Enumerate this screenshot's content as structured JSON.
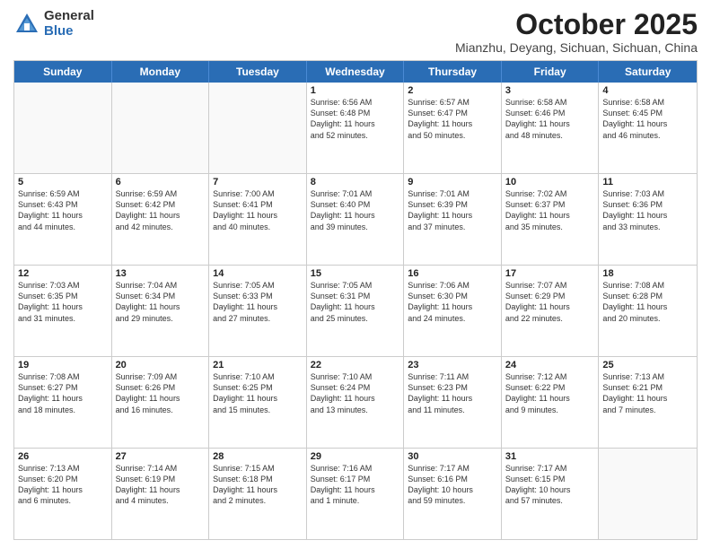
{
  "logo": {
    "general": "General",
    "blue": "Blue"
  },
  "title": {
    "month": "October 2025",
    "location": "Mianzhu, Deyang, Sichuan, Sichuan, China"
  },
  "header_days": [
    "Sunday",
    "Monday",
    "Tuesday",
    "Wednesday",
    "Thursday",
    "Friday",
    "Saturday"
  ],
  "weeks": [
    [
      {
        "day": "",
        "info": ""
      },
      {
        "day": "",
        "info": ""
      },
      {
        "day": "",
        "info": ""
      },
      {
        "day": "1",
        "info": "Sunrise: 6:56 AM\nSunset: 6:48 PM\nDaylight: 11 hours\nand 52 minutes."
      },
      {
        "day": "2",
        "info": "Sunrise: 6:57 AM\nSunset: 6:47 PM\nDaylight: 11 hours\nand 50 minutes."
      },
      {
        "day": "3",
        "info": "Sunrise: 6:58 AM\nSunset: 6:46 PM\nDaylight: 11 hours\nand 48 minutes."
      },
      {
        "day": "4",
        "info": "Sunrise: 6:58 AM\nSunset: 6:45 PM\nDaylight: 11 hours\nand 46 minutes."
      }
    ],
    [
      {
        "day": "5",
        "info": "Sunrise: 6:59 AM\nSunset: 6:43 PM\nDaylight: 11 hours\nand 44 minutes."
      },
      {
        "day": "6",
        "info": "Sunrise: 6:59 AM\nSunset: 6:42 PM\nDaylight: 11 hours\nand 42 minutes."
      },
      {
        "day": "7",
        "info": "Sunrise: 7:00 AM\nSunset: 6:41 PM\nDaylight: 11 hours\nand 40 minutes."
      },
      {
        "day": "8",
        "info": "Sunrise: 7:01 AM\nSunset: 6:40 PM\nDaylight: 11 hours\nand 39 minutes."
      },
      {
        "day": "9",
        "info": "Sunrise: 7:01 AM\nSunset: 6:39 PM\nDaylight: 11 hours\nand 37 minutes."
      },
      {
        "day": "10",
        "info": "Sunrise: 7:02 AM\nSunset: 6:37 PM\nDaylight: 11 hours\nand 35 minutes."
      },
      {
        "day": "11",
        "info": "Sunrise: 7:03 AM\nSunset: 6:36 PM\nDaylight: 11 hours\nand 33 minutes."
      }
    ],
    [
      {
        "day": "12",
        "info": "Sunrise: 7:03 AM\nSunset: 6:35 PM\nDaylight: 11 hours\nand 31 minutes."
      },
      {
        "day": "13",
        "info": "Sunrise: 7:04 AM\nSunset: 6:34 PM\nDaylight: 11 hours\nand 29 minutes."
      },
      {
        "day": "14",
        "info": "Sunrise: 7:05 AM\nSunset: 6:33 PM\nDaylight: 11 hours\nand 27 minutes."
      },
      {
        "day": "15",
        "info": "Sunrise: 7:05 AM\nSunset: 6:31 PM\nDaylight: 11 hours\nand 25 minutes."
      },
      {
        "day": "16",
        "info": "Sunrise: 7:06 AM\nSunset: 6:30 PM\nDaylight: 11 hours\nand 24 minutes."
      },
      {
        "day": "17",
        "info": "Sunrise: 7:07 AM\nSunset: 6:29 PM\nDaylight: 11 hours\nand 22 minutes."
      },
      {
        "day": "18",
        "info": "Sunrise: 7:08 AM\nSunset: 6:28 PM\nDaylight: 11 hours\nand 20 minutes."
      }
    ],
    [
      {
        "day": "19",
        "info": "Sunrise: 7:08 AM\nSunset: 6:27 PM\nDaylight: 11 hours\nand 18 minutes."
      },
      {
        "day": "20",
        "info": "Sunrise: 7:09 AM\nSunset: 6:26 PM\nDaylight: 11 hours\nand 16 minutes."
      },
      {
        "day": "21",
        "info": "Sunrise: 7:10 AM\nSunset: 6:25 PM\nDaylight: 11 hours\nand 15 minutes."
      },
      {
        "day": "22",
        "info": "Sunrise: 7:10 AM\nSunset: 6:24 PM\nDaylight: 11 hours\nand 13 minutes."
      },
      {
        "day": "23",
        "info": "Sunrise: 7:11 AM\nSunset: 6:23 PM\nDaylight: 11 hours\nand 11 minutes."
      },
      {
        "day": "24",
        "info": "Sunrise: 7:12 AM\nSunset: 6:22 PM\nDaylight: 11 hours\nand 9 minutes."
      },
      {
        "day": "25",
        "info": "Sunrise: 7:13 AM\nSunset: 6:21 PM\nDaylight: 11 hours\nand 7 minutes."
      }
    ],
    [
      {
        "day": "26",
        "info": "Sunrise: 7:13 AM\nSunset: 6:20 PM\nDaylight: 11 hours\nand 6 minutes."
      },
      {
        "day": "27",
        "info": "Sunrise: 7:14 AM\nSunset: 6:19 PM\nDaylight: 11 hours\nand 4 minutes."
      },
      {
        "day": "28",
        "info": "Sunrise: 7:15 AM\nSunset: 6:18 PM\nDaylight: 11 hours\nand 2 minutes."
      },
      {
        "day": "29",
        "info": "Sunrise: 7:16 AM\nSunset: 6:17 PM\nDaylight: 11 hours\nand 1 minute."
      },
      {
        "day": "30",
        "info": "Sunrise: 7:17 AM\nSunset: 6:16 PM\nDaylight: 10 hours\nand 59 minutes."
      },
      {
        "day": "31",
        "info": "Sunrise: 7:17 AM\nSunset: 6:15 PM\nDaylight: 10 hours\nand 57 minutes."
      },
      {
        "day": "",
        "info": ""
      }
    ]
  ]
}
